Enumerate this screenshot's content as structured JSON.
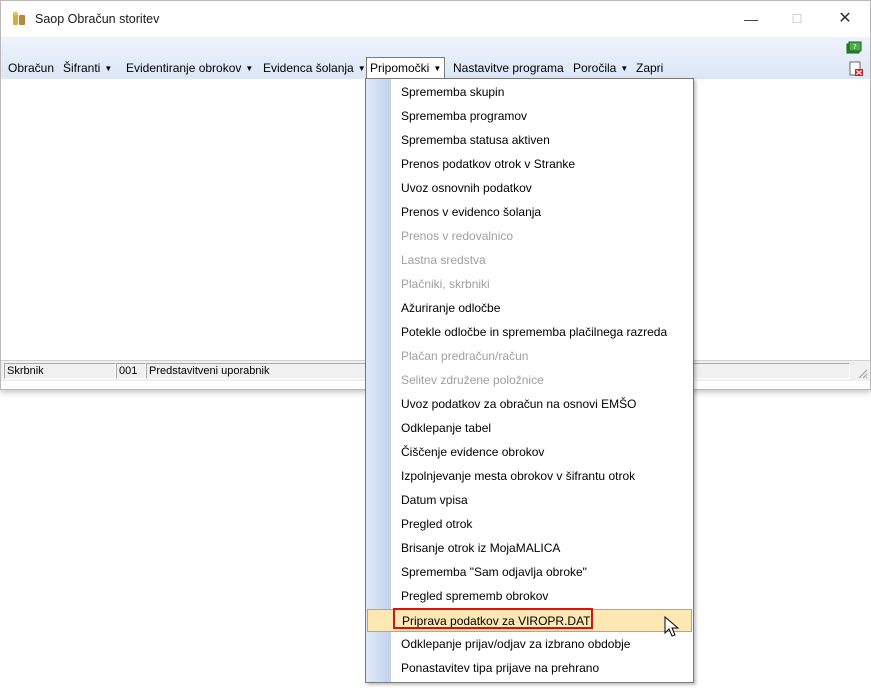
{
  "window": {
    "title": "Saop Obračun storitev"
  },
  "menubar": {
    "items": [
      {
        "label": "Obračun",
        "arrow": ""
      },
      {
        "label": "Šifranti",
        "arrow": "▼"
      },
      {
        "label": "Evidentiranje obrokov",
        "arrow": "▼"
      },
      {
        "label": "Evidenca šolanja",
        "arrow": "▼"
      },
      {
        "label": "Pripomočki",
        "arrow": "▼"
      },
      {
        "label": "Nastavitve programa",
        "arrow": ""
      },
      {
        "label": "Poročila",
        "arrow": "▼"
      },
      {
        "label": "Zapri",
        "arrow": ""
      }
    ],
    "active_item": "Pripomočki"
  },
  "toolbar_icons": [
    "book-help-icon",
    "exit-document-icon"
  ],
  "statusbar": {
    "user_label": "Skrbnik",
    "code": "001",
    "user_name": "Predstavitveni uporabnik"
  },
  "dropdown": {
    "items": [
      {
        "label": "Sprememba skupin",
        "disabled": false
      },
      {
        "label": "Sprememba programov",
        "disabled": false
      },
      {
        "label": "Sprememba statusa aktiven",
        "disabled": false
      },
      {
        "label": "Prenos podatkov otrok v Stranke",
        "disabled": false
      },
      {
        "label": "Uvoz osnovnih podatkov",
        "disabled": false
      },
      {
        "label": "Prenos v evidenco šolanja",
        "disabled": false
      },
      {
        "label": "Prenos v redovalnico",
        "disabled": true
      },
      {
        "label": "Lastna sredstva",
        "disabled": true
      },
      {
        "label": "Plačniki, skrbniki",
        "disabled": true
      },
      {
        "label": "Ažuriranje odločbe",
        "disabled": false
      },
      {
        "label": "Potekle odločbe in sprememba plačilnega razreda",
        "disabled": false
      },
      {
        "label": "Plačan predračun/račun",
        "disabled": true
      },
      {
        "label": "Selitev združene položnice",
        "disabled": true
      },
      {
        "label": "Uvoz podatkov za obračun na osnovi EMŠO",
        "disabled": false
      },
      {
        "label": "Odklepanje  tabel",
        "disabled": false
      },
      {
        "label": "Čiščenje evidence obrokov",
        "disabled": false
      },
      {
        "label": "Izpolnjevanje mesta obrokov v šifrantu otrok",
        "disabled": false
      },
      {
        "label": "Datum vpisa",
        "disabled": false
      },
      {
        "label": "Pregled otrok",
        "disabled": false
      },
      {
        "label": "Brisanje otrok iz MojaMALICA",
        "disabled": false
      },
      {
        "label": "Sprememba \"Sam odjavlja obroke\"",
        "disabled": false
      },
      {
        "label": "Pregled sprememb obrokov",
        "disabled": false
      },
      {
        "label": "Priprava podatkov za VIROPR.DAT",
        "disabled": false
      },
      {
        "label": "Odklepanje prijav/odjav za izbrano obdobje",
        "disabled": false
      },
      {
        "label": "Ponastavitev tipa prijave na prehrano",
        "disabled": false
      }
    ],
    "highlighted_item": "Priprava podatkov za VIROPR.DAT"
  },
  "colors": {
    "menu_bg": "#dbe6f6",
    "highlight_bg": "#fde7b3",
    "annotation_box": "#e01010",
    "disabled_text": "#a0a0a0"
  }
}
